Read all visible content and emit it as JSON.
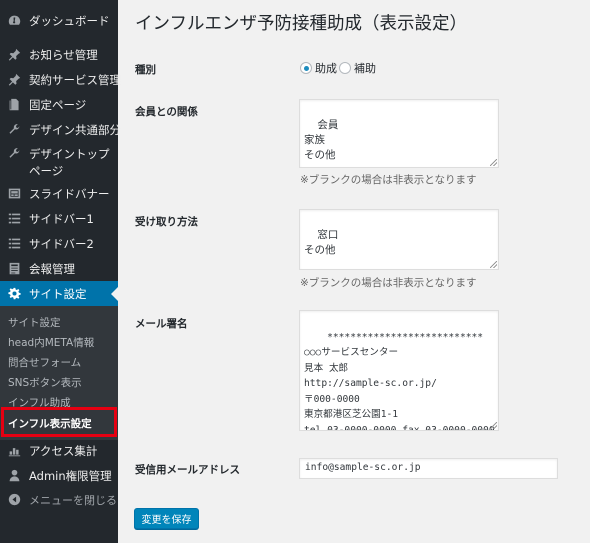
{
  "sidebar": {
    "items": [
      {
        "label": "ダッシュボード",
        "icon": "dashboard-icon"
      },
      {
        "label": "お知らせ管理",
        "icon": "pin-icon"
      },
      {
        "label": "契約サービス管理",
        "icon": "pin-icon"
      },
      {
        "label": "固定ページ",
        "icon": "page-icon"
      },
      {
        "label": "デザイン共通部分",
        "icon": "wrench-icon"
      },
      {
        "label": "デザイントップページ",
        "icon": "wrench-icon"
      },
      {
        "label": "スライドバナー",
        "icon": "slides-icon"
      },
      {
        "label": "サイドバー1",
        "icon": "list-icon"
      },
      {
        "label": "サイドバー2",
        "icon": "list-icon"
      },
      {
        "label": "会報管理",
        "icon": "document-icon"
      },
      {
        "label": "サイト設定",
        "icon": "gear-icon"
      }
    ],
    "submenu": [
      "サイト設定",
      "head内META情報",
      "問合せフォーム",
      "SNSボタン表示",
      "インフル助成",
      "インフル表示設定"
    ],
    "bottom_items": [
      {
        "label": "アクセス集計",
        "icon": "chart-icon"
      },
      {
        "label": "Admin権限管理",
        "icon": "user-icon"
      },
      {
        "label": "メニューを閉じる",
        "icon": "collapse-icon"
      }
    ]
  },
  "page": {
    "title": "インフルエンザ予防接種助成（表示設定）",
    "type_label": "種別",
    "type_options": [
      "助成",
      "補助"
    ],
    "type_selected": "助成",
    "relation_label": "会員との関係",
    "relation_value": "会員\n家族\nその他",
    "blank_hint": "※ブランクの場合は非表示となります",
    "receive_label": "受け取り方法",
    "receive_value": "窓口\nその他",
    "signature_label": "メール署名",
    "signature_value": "***************************\n○○○サービスセンター\n見本 太郎\nhttp://sample-sc.or.jp/\n〒000-0000\n東京都港区芝公園1-1\ntel 03-0000-0000 fax 03-0000-0000",
    "email_label": "受信用メールアドレス",
    "email_value": "info@sample-sc.or.jp",
    "save_label": "変更を保存"
  }
}
